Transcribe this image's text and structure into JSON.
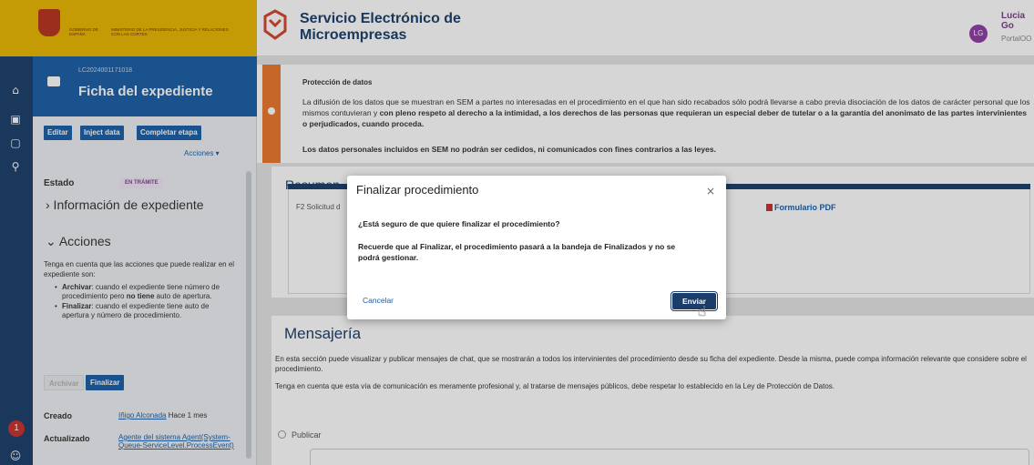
{
  "gov": {
    "left_text": "GOBIERNO DE ESPAÑA",
    "right_text": "MINISTERIO DE LA PRESIDENCIA, JUSTICIA Y RELACIONES CON LAS CORTES"
  },
  "header": {
    "app_title": "Servicio Electrónico de Microempresas",
    "user_name": "Lucia Go",
    "user_initials": "LG",
    "user_portal": "PortalOO"
  },
  "sidebar": {
    "expediente_code": "LC2024001171018",
    "title": "Ficha del expediente",
    "buttons": [
      "Editar",
      "Inject data",
      "Completar etapa"
    ],
    "acciones_dropdown": "Acciones ▾",
    "estado_label": "Estado",
    "estado_value": "EN TRÁMITE",
    "info_section": "› Información de expediente",
    "acciones_section": "⌄ Acciones",
    "acciones_desc": "Tenga en cuenta que las acciones que puede realizar en el expediente son:",
    "acciones_items": [
      {
        "bold": "Archivar",
        "text": ": cuando el expediente tiene número de procedimiento pero ",
        "bold2": "no tiene",
        "text2": " auto de apertura."
      },
      {
        "bold": "Finalizar",
        "text": ": cuando el expediente tiene auto de apertura y número de procedimiento.",
        "bold2": "",
        "text2": ""
      }
    ],
    "archivar_button": "Archivar",
    "finalizar_button": "Finalizar",
    "creado_label": "Creado",
    "creado_user": "Iñigo Alconada",
    "creado_time": " Hace 1 mes",
    "actualizado_label": "Actualizado",
    "actualizado_value": "Agente del sistema Agent(System-Queue-ServiceLevel.ProcessEvent)"
  },
  "proteccion": {
    "title": "Protección de datos",
    "p1_a": "La difusión de los datos que se muestran en SEM a partes no interesadas en el procedimiento en el que han sido recabados sólo podrá llevarse a cabo previa disociación de los datos de carácter personal que los mismos contuvieran y ",
    "p1_b": "con pleno respeto al derecho a la intimidad, a los derechos de las personas que requieran un especial deber de tutelar o a la garantía del anonimato de las partes intervinientes o perjudicados, cuando proceda.",
    "p2": "Los datos personales incluidos en SEM no podrán ser cedidos, ni comunicados con fines contrarios a las leyes."
  },
  "resumen": {
    "title": "Resumen",
    "row_text": "F2 Solicitud d",
    "pdf_link": "Formulario PDF"
  },
  "mensajeria": {
    "title": "Mensajería",
    "p1": "En esta sección puede visualizar y publicar mensajes de chat, que se mostrarán a todos los intervinientes del procedimiento desde su ficha del expediente. Desde la misma, puede compa información relevante que considere sobre el procedimiento.",
    "p2": "Tenga en cuenta que esta vía de comunicación es meramente profesional y, al tratarse de mensajes públicos, debe respetar lo establecido en la Ley de Protección de Datos.",
    "publicar": "Publicar"
  },
  "modal": {
    "title": "Finalizar procedimiento",
    "close": "×",
    "question": "¿Está seguro de que quiere finalizar el procedimiento?",
    "note": "Recuerde que al Finalizar, el procedimiento pasará a la bandeja de Finalizados y no se podrá gestionar.",
    "cancel": "Cancelar",
    "send": "Enviar"
  },
  "notifications": {
    "count": "1"
  },
  "colors": {
    "primary": "#1a5fa8",
    "navy": "#1a3d6b",
    "warning": "#e9782d",
    "gov_yellow": "#eab700"
  },
  "icons": [
    "home-icon",
    "inbox-icon",
    "document-icon",
    "search-icon",
    "bell-icon",
    "user-icon",
    "briefcase-icon",
    "close-icon",
    "pdf-icon"
  ]
}
